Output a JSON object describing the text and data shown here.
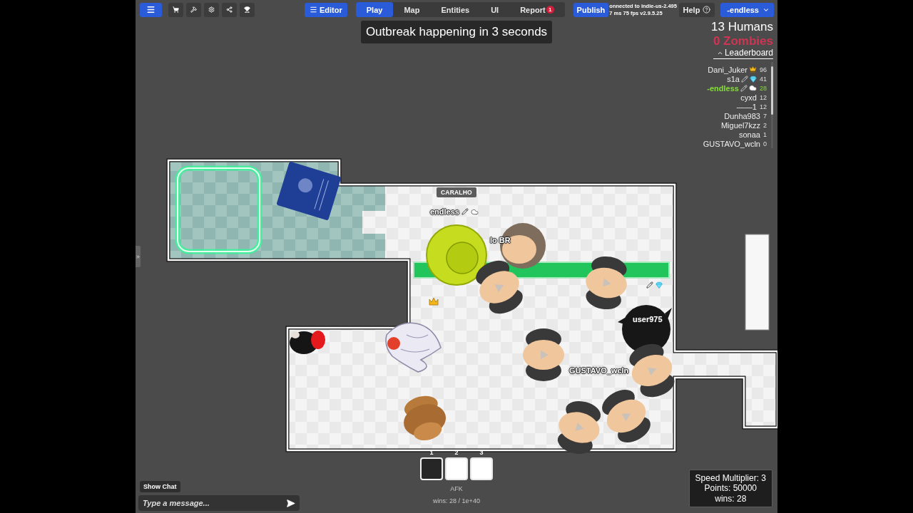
{
  "top_bar": {
    "editor_button": "Editor",
    "tabs": [
      {
        "label": "Play",
        "selected": true
      },
      {
        "label": "Map",
        "selected": false
      },
      {
        "label": "Entities",
        "selected": false
      },
      {
        "label": "UI",
        "selected": false
      },
      {
        "label": "Report",
        "selected": false,
        "badge": "1"
      }
    ],
    "publish_button": "Publish",
    "connection": [
      "onnected to indie-us-2.495",
      "7 ms 75 fps v2.9.5.25"
    ],
    "help_button": "Help",
    "account_button": "-endless"
  },
  "banner": "Outbreak happening in 3 seconds",
  "scoreboard": {
    "humans": "13 Humans",
    "zombies": "0 Zombies",
    "leaderboard_toggle": {
      "label": "Leaderboard",
      "expanded": true
    },
    "entries": [
      {
        "name": "Dani_Juker",
        "crown": true,
        "pencil": false,
        "gem": false,
        "cloud": false,
        "score": "96",
        "highlighted": false
      },
      {
        "name": "s1a",
        "crown": false,
        "pencil": true,
        "gem": true,
        "cloud": false,
        "score": "41",
        "highlighted": false
      },
      {
        "name": "-endless",
        "crown": false,
        "pencil": true,
        "gem": false,
        "cloud": true,
        "score": "28",
        "highlighted": true
      },
      {
        "name": "cyxd",
        "crown": false,
        "pencil": false,
        "gem": false,
        "cloud": false,
        "score": "12",
        "highlighted": false
      },
      {
        "name": "——1",
        "crown": false,
        "pencil": false,
        "gem": false,
        "cloud": false,
        "score": "12",
        "highlighted": false
      },
      {
        "name": "Dunha983",
        "crown": false,
        "pencil": false,
        "gem": false,
        "cloud": false,
        "score": "7",
        "highlighted": false
      },
      {
        "name": "Miguel7kzz",
        "crown": false,
        "pencil": false,
        "gem": false,
        "cloud": false,
        "score": "2",
        "highlighted": false
      },
      {
        "name": "sonaa",
        "crown": false,
        "pencil": false,
        "gem": false,
        "cloud": false,
        "score": "1",
        "highlighted": false
      },
      {
        "name": "GUSTAVO_wcln",
        "crown": false,
        "pencil": false,
        "gem": false,
        "cloud": false,
        "score": "0",
        "highlighted": false
      }
    ]
  },
  "map": {
    "sign": "CARALHO",
    "name_tags": [
      {
        "name": "endless",
        "crown": false,
        "pencil": true,
        "gem": false,
        "cloud": true
      },
      {
        "name": "lo BR",
        "crown": false,
        "pencil": false,
        "gem": false,
        "cloud": false
      },
      {
        "name": "user975",
        "crown": false,
        "pencil": false,
        "gem": false,
        "cloud": false
      },
      {
        "name": "GUSTAVO_wcln",
        "crown": false,
        "pencil": false,
        "gem": false,
        "cloud": false
      }
    ]
  },
  "hotbar": {
    "slots": [
      {
        "number": "1",
        "selected": true
      },
      {
        "number": "2",
        "selected": false
      },
      {
        "number": "3",
        "selected": false
      }
    ],
    "status": "AFK",
    "wins": "wins: 28 / 1e+40"
  },
  "chat": {
    "toggle_button": "Show Chat",
    "input": {
      "placeholder": "Type a message..."
    }
  },
  "stats": [
    "Speed Multiplier: 3",
    "Points: 50000",
    "wins: 28"
  ]
}
